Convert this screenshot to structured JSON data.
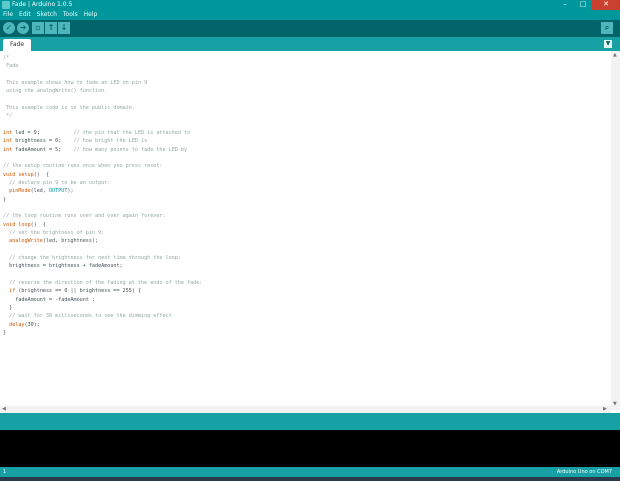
{
  "window": {
    "title": "Fade | Arduino 1.0.5",
    "minimize_glyph": "–",
    "maximize_glyph": "□",
    "close_glyph": "✕"
  },
  "menu": [
    "File",
    "Edit",
    "Sketch",
    "Tools",
    "Help"
  ],
  "toolbar": {
    "verify_glyph": "✓",
    "upload_glyph": "➜",
    "new_glyph": "▫",
    "open_glyph": "↑",
    "save_glyph": "↓",
    "serial_glyph": "⌕"
  },
  "tabs": [
    {
      "label": "Fade"
    }
  ],
  "tab_menu_glyph": "▼",
  "code": [
    [
      {
        "t": "/*",
        "c": "cm"
      }
    ],
    [
      {
        "t": " Fade",
        "c": "cm"
      }
    ],
    [
      {
        "t": "",
        "c": "cm"
      }
    ],
    [
      {
        "t": " This example shows how to fade an LED on pin 9",
        "c": "cm"
      }
    ],
    [
      {
        "t": " using the analogWrite() function.",
        "c": "cm"
      }
    ],
    [
      {
        "t": "",
        "c": "cm"
      }
    ],
    [
      {
        "t": " This example code is in the public domain.",
        "c": "cm"
      }
    ],
    [
      {
        "t": " */",
        "c": "cm"
      }
    ],
    [
      {
        "t": "",
        "c": ""
      }
    ],
    [
      {
        "t": "int",
        "c": "kw"
      },
      {
        "t": " led = 9;           ",
        "c": ""
      },
      {
        "t": "// the pin that the LED is attached to",
        "c": "cm"
      }
    ],
    [
      {
        "t": "int",
        "c": "kw"
      },
      {
        "t": " brightness = 0;    ",
        "c": ""
      },
      {
        "t": "// how bright the LED is",
        "c": "cm"
      }
    ],
    [
      {
        "t": "int",
        "c": "kw"
      },
      {
        "t": " fadeAmount = 5;    ",
        "c": ""
      },
      {
        "t": "// how many points to fade the LED by",
        "c": "cm"
      }
    ],
    [
      {
        "t": "",
        "c": ""
      }
    ],
    [
      {
        "t": "// the setup routine runs once when you press reset:",
        "c": "cm"
      }
    ],
    [
      {
        "t": "void",
        "c": "kw"
      },
      {
        "t": " ",
        "c": ""
      },
      {
        "t": "setup",
        "c": "fn"
      },
      {
        "t": "()  {",
        "c": ""
      }
    ],
    [
      {
        "t": "  // declare pin 9 to be an output:",
        "c": "cm"
      }
    ],
    [
      {
        "t": "  ",
        "c": ""
      },
      {
        "t": "pinMode",
        "c": "fn"
      },
      {
        "t": "(led, ",
        "c": ""
      },
      {
        "t": "OUTPUT",
        "c": "const"
      },
      {
        "t": ");",
        "c": ""
      }
    ],
    [
      {
        "t": "}",
        "c": ""
      }
    ],
    [
      {
        "t": "",
        "c": ""
      }
    ],
    [
      {
        "t": "// the loop routine runs over and over again forever:",
        "c": "cm"
      }
    ],
    [
      {
        "t": "void",
        "c": "kw"
      },
      {
        "t": " ",
        "c": ""
      },
      {
        "t": "loop",
        "c": "fn"
      },
      {
        "t": "()  {",
        "c": ""
      }
    ],
    [
      {
        "t": "  // set the brightness of pin 9:",
        "c": "cm"
      }
    ],
    [
      {
        "t": "  ",
        "c": ""
      },
      {
        "t": "analogWrite",
        "c": "fn"
      },
      {
        "t": "(led, brightness);",
        "c": ""
      }
    ],
    [
      {
        "t": "",
        "c": ""
      }
    ],
    [
      {
        "t": "  // change the brightness for next time through the loop:",
        "c": "cm"
      }
    ],
    [
      {
        "t": "  brightness = brightness + fadeAmount;",
        "c": ""
      }
    ],
    [
      {
        "t": "",
        "c": ""
      }
    ],
    [
      {
        "t": "  // reverse the direction of the fading at the ends of the fade:",
        "c": "cm"
      }
    ],
    [
      {
        "t": "  ",
        "c": ""
      },
      {
        "t": "if",
        "c": "kw"
      },
      {
        "t": " (brightness == 0 || brightness == 255) {",
        "c": ""
      }
    ],
    [
      {
        "t": "    fadeAmount = -fadeAmount ;",
        "c": ""
      }
    ],
    [
      {
        "t": "  }",
        "c": ""
      }
    ],
    [
      {
        "t": "  // wait for 30 milliseconds to see the dimming effect",
        "c": "cm"
      }
    ],
    [
      {
        "t": "  ",
        "c": ""
      },
      {
        "t": "delay",
        "c": "fn"
      },
      {
        "t": "(30);",
        "c": ""
      }
    ],
    [
      {
        "t": "}",
        "c": ""
      }
    ]
  ],
  "scroll": {
    "up": "▲",
    "down": "▼",
    "left": "◀",
    "right": "▶"
  },
  "status": {
    "line_number": "1",
    "board": "Arduino Uno on COM7"
  },
  "colors": {
    "teal": "#00979c",
    "dark_teal": "#006468",
    "keyword": "#d35400",
    "comment": "#95a5a6",
    "constant": "#00979c"
  }
}
